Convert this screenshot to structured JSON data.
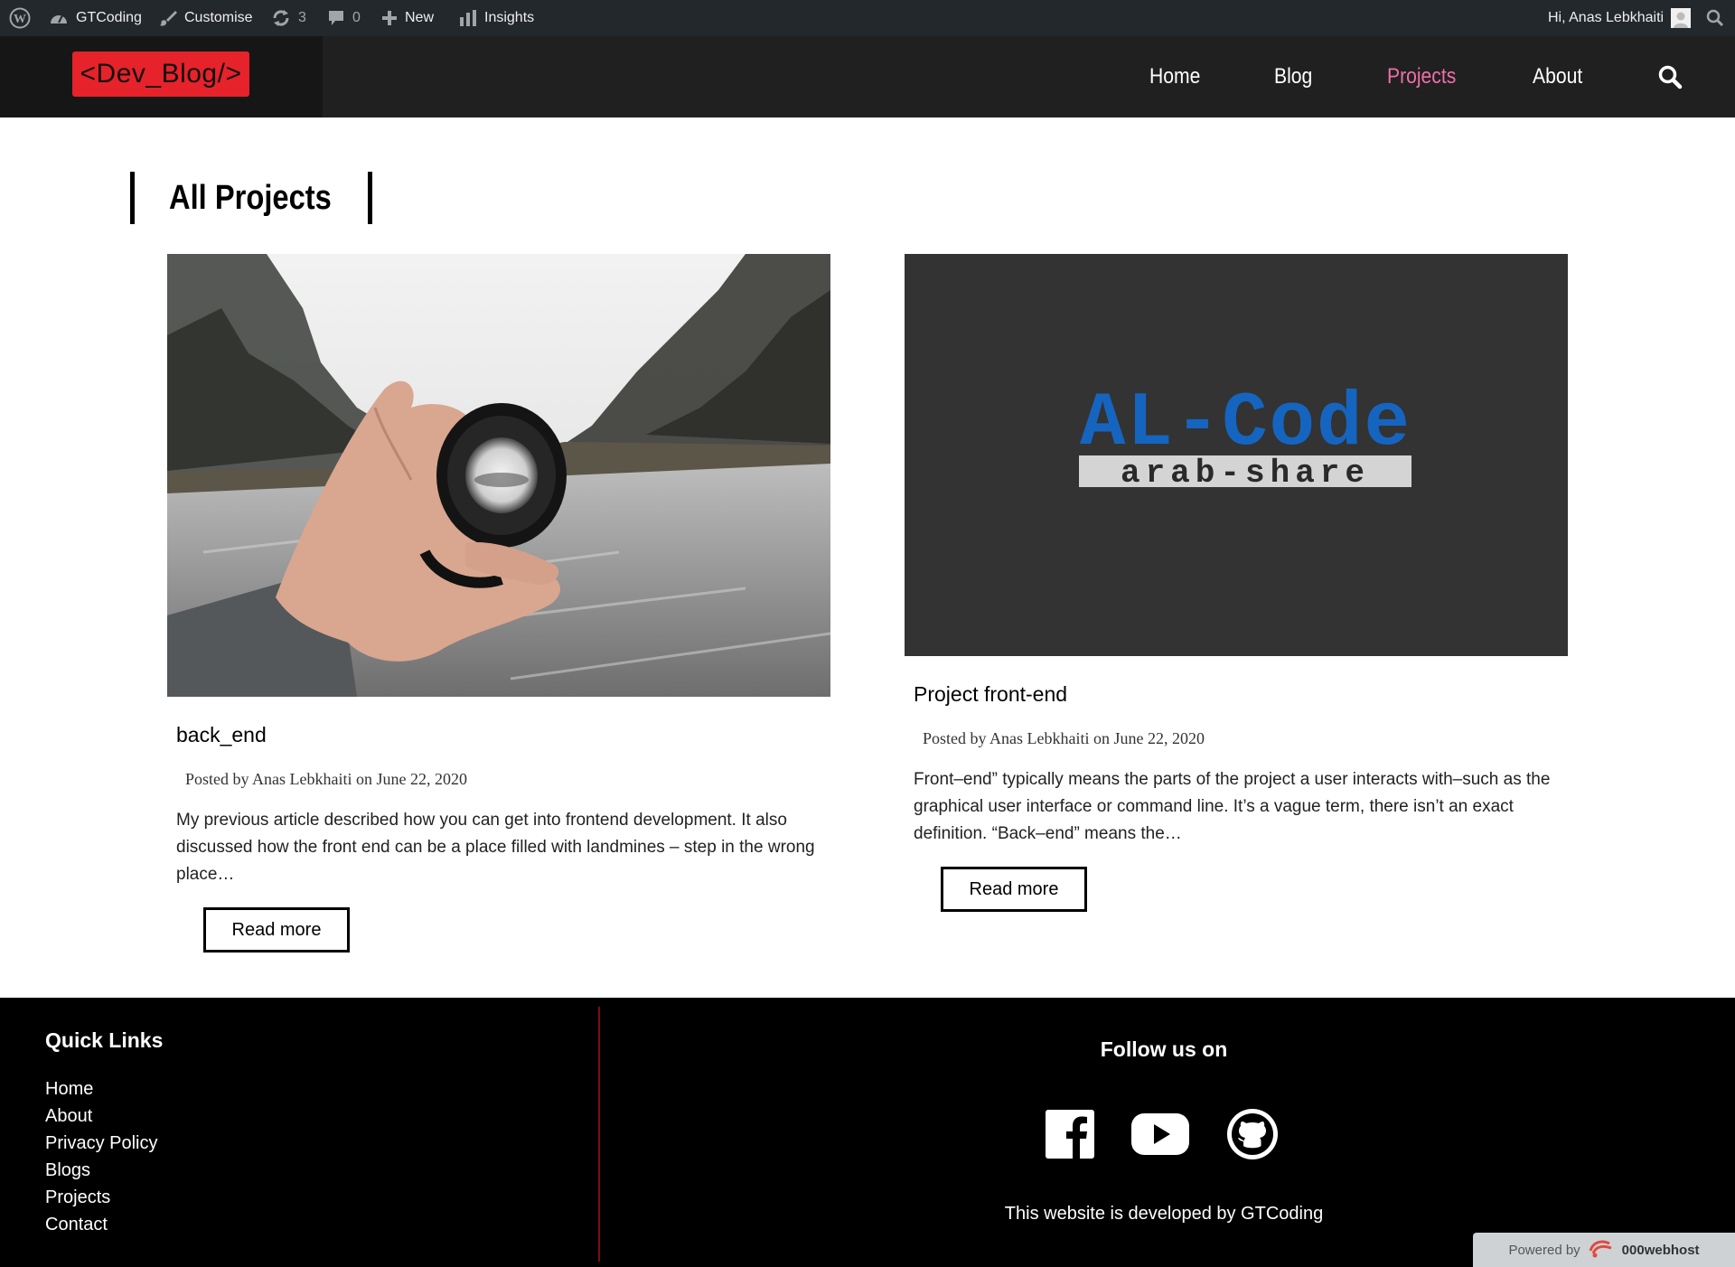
{
  "admin_bar": {
    "site_name": "GTCoding",
    "customise": "Customise",
    "updates_count": "3",
    "comments_count": "0",
    "new": "New",
    "insights": "Insights",
    "greeting": "Hi, Anas Lebkhaiti"
  },
  "header": {
    "logo_text": "<Dev_Blog/>",
    "nav": [
      {
        "label": "Home",
        "active": false
      },
      {
        "label": "Blog",
        "active": false
      },
      {
        "label": "Projects",
        "active": true
      },
      {
        "label": "About",
        "active": false
      }
    ]
  },
  "main": {
    "section_title": "All Projects",
    "posts": [
      {
        "title": "back_end",
        "meta": "Posted by Anas Lebkhaiti on June 22, 2020",
        "excerpt": "My previous article described how you can get into frontend development. It also discussed how the front end can be a place filled with landmines – step in the wrong place…",
        "read_more": "Read more",
        "image": "hand holding camera lens over lake"
      },
      {
        "title": "Project front-end",
        "meta": "Posted by Anas Lebkhaiti on June 22, 2020",
        "excerpt": "Front–end” typically means the parts of the project a user interacts with–such as the graphical user interface or command line. It’s a vague term, there isn’t an exact definition. “Back–end” means the…",
        "read_more": "Read more",
        "image": "AL-Code arab-share logo",
        "image_text_main": "AL-Code",
        "image_text_sub": "arab-share"
      }
    ]
  },
  "footer": {
    "quick_links_title": "Quick Links",
    "quick_links": [
      "Home",
      "About",
      "Privacy Policy",
      "Blogs",
      "Projects",
      "Contact"
    ],
    "follow_title": "Follow us on",
    "social": [
      "facebook-icon",
      "youtube-icon",
      "github-icon"
    ],
    "credit": "This website is developed by GTCoding",
    "powered_by": "Powered by",
    "powered_brand": "000webhost"
  },
  "colors": {
    "admin_bar": "#23282d",
    "header": "#202020",
    "logo": "#e6222a",
    "nav_active": "#f06eaa",
    "footer": "#000000",
    "footer_divider": "#7a1010"
  }
}
